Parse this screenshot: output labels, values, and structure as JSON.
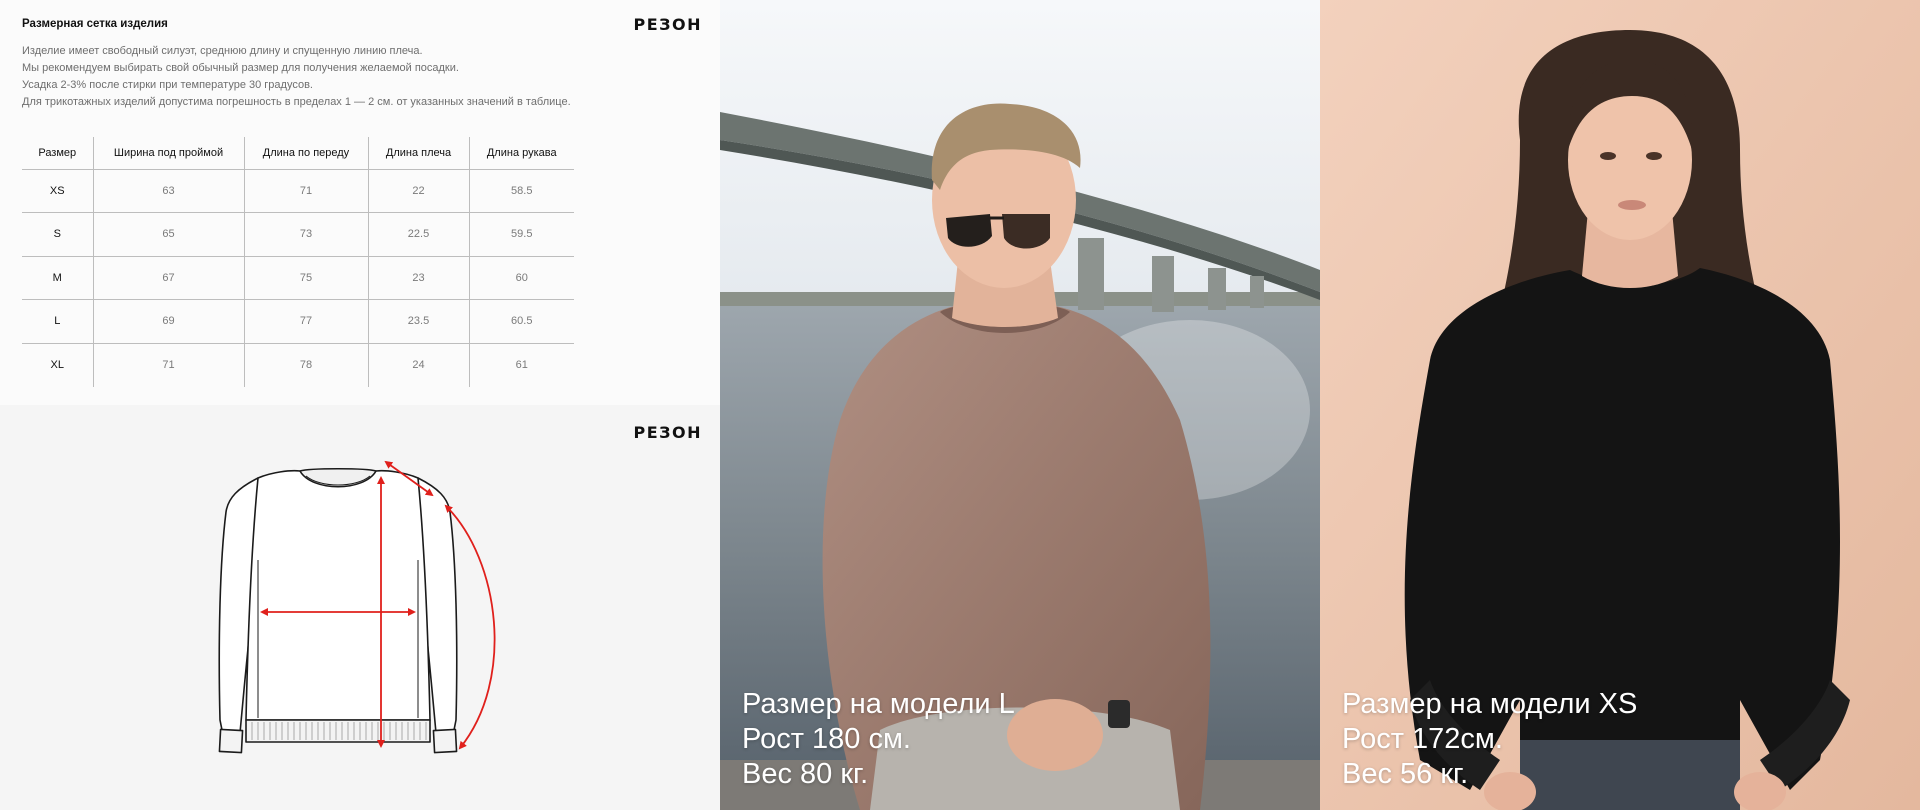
{
  "brand": "РЕЗОН",
  "size_chart": {
    "title": "Размерная сетка изделия",
    "description": [
      "Изделие имеет свободный силуэт, среднюю длину и спущенную линию плеча.",
      "Мы рекомендуем выбирать свой обычный размер для получения желаемой посадки.",
      "Усадка 2-3% после стирки при температуре 30 градусов.",
      "Для трикотажных изделий допустима погрешность в пределах  1 — 2 см. от указанных значений в таблице."
    ],
    "columns": [
      "Размер",
      "Ширина под проймой",
      "Длина по переду",
      "Длина плеча",
      "Длина рукава"
    ],
    "rows": [
      [
        "XS",
        "63",
        "71",
        "22",
        "58.5"
      ],
      [
        "S",
        "65",
        "73",
        "22.5",
        "59.5"
      ],
      [
        "M",
        "67",
        "75",
        "23",
        "60"
      ],
      [
        "L",
        "69",
        "77",
        "23.5",
        "60.5"
      ],
      [
        "XL",
        "71",
        "78",
        "24",
        "61"
      ]
    ]
  },
  "models": [
    {
      "size_line": "Размер на модели L",
      "height_line": "Рост 180 см.",
      "weight_line": "Вес 80 кг."
    },
    {
      "size_line": "Размер на модели XS",
      "height_line": "Рост 172см.",
      "weight_line": "Вес 56 кг."
    }
  ],
  "colors": {
    "measurement_arrow": "#e0201c",
    "sweater_man": "#a08073",
    "sweater_woman": "#141414",
    "wall_woman": "#efc9b3"
  }
}
